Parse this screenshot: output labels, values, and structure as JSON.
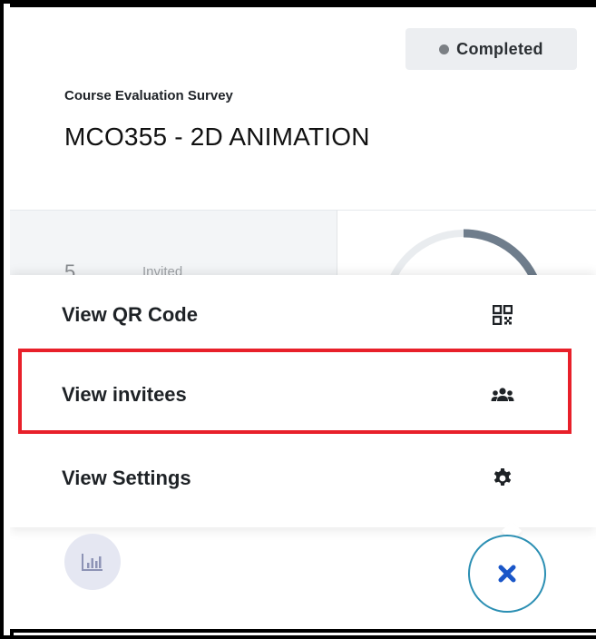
{
  "status": {
    "label": "Completed"
  },
  "survey": {
    "type": "Course Evaluation Survey",
    "title": "MCO355 - 2D ANIMATION"
  },
  "stats": {
    "invited_count": "5",
    "invited_label": "Invited"
  },
  "menu": {
    "items": [
      {
        "label": "View QR Code",
        "icon": "qr-code-icon"
      },
      {
        "label": "View invitees",
        "icon": "users-icon"
      },
      {
        "label": "View Settings",
        "icon": "gear-icon"
      }
    ]
  },
  "fabs": {
    "chart_icon": "bar-chart-icon",
    "close_icon": "close-icon"
  },
  "colors": {
    "highlight": "#e8202a",
    "accent_blue": "#1a56c8",
    "fab_border": "#2b8fb3",
    "badge_bg": "#eceef1"
  }
}
